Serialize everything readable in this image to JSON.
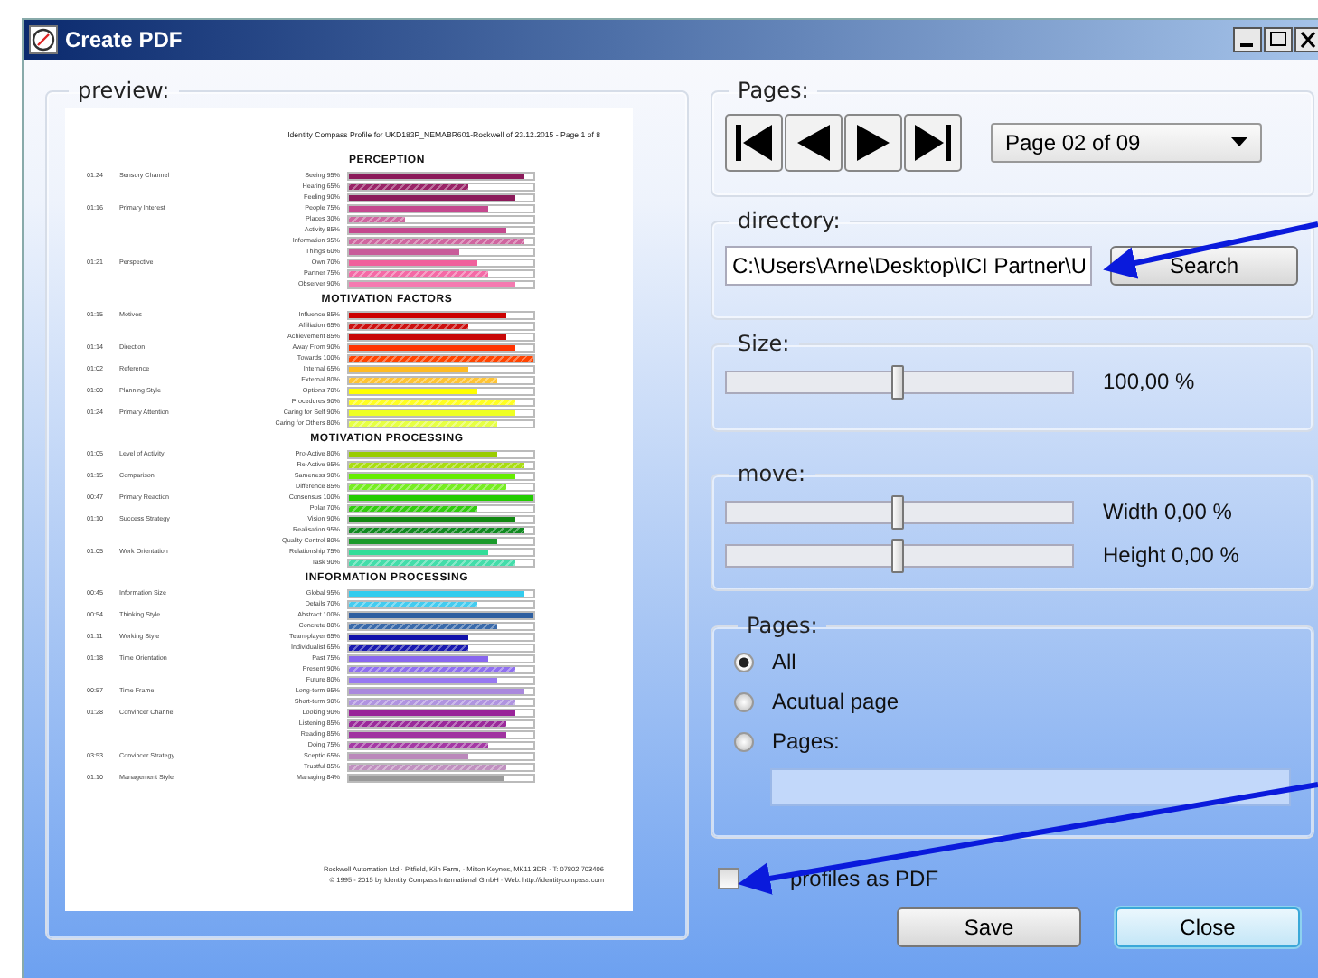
{
  "window": {
    "title": "Create PDF"
  },
  "preview": {
    "label": "preview:",
    "header": "Identity Compass Profile for UKD183P_NEMABR601-Rockwell of 23.12.2015 - Page 1 of 8",
    "sections": [
      {
        "title": "PERCEPTION",
        "groups": [
          {
            "time": "01:24",
            "name": "Sensory Channel",
            "rows": [
              {
                "label": "Seeing 95%",
                "level": 0.95,
                "color": "#8b1a5a"
              },
              {
                "label": "Hearing 65%",
                "level": 0.65,
                "color": "#9a2468"
              },
              {
                "label": "Feeling 90%",
                "level": 0.9,
                "color": "#8b1a5a"
              }
            ]
          },
          {
            "time": "01:16",
            "name": "Primary Interest",
            "rows": [
              {
                "label": "People 75%",
                "level": 0.75,
                "color": "#c4488e"
              },
              {
                "label": "Places 30%",
                "level": 0.3,
                "color": "#d066a0"
              },
              {
                "label": "Activity 85%",
                "level": 0.85,
                "color": "#c4488e"
              },
              {
                "label": "Information 95%",
                "level": 0.95,
                "color": "#d066a0"
              },
              {
                "label": "Things 60%",
                "level": 0.6,
                "color": "#c85c9a"
              }
            ]
          },
          {
            "time": "01:21",
            "name": "Perspective",
            "rows": [
              {
                "label": "Own 70%",
                "level": 0.7,
                "color": "#f0609c"
              },
              {
                "label": "Partner 75%",
                "level": 0.75,
                "color": "#f46aa6"
              },
              {
                "label": "Observer 90%",
                "level": 0.9,
                "color": "#f47ab0"
              }
            ]
          }
        ]
      },
      {
        "title": "MOTIVATION FACTORS",
        "groups": [
          {
            "time": "01:15",
            "name": "Motives",
            "rows": [
              {
                "label": "Influence 85%",
                "level": 0.85,
                "color": "#cc0000"
              },
              {
                "label": "Affiliation 65%",
                "level": 0.65,
                "color": "#cc1010"
              },
              {
                "label": "Achievement 85%",
                "level": 0.85,
                "color": "#c80808"
              }
            ]
          },
          {
            "time": "01:14",
            "name": "Direction",
            "rows": [
              {
                "label": "Away From 90%",
                "level": 0.9,
                "color": "#ff3300"
              },
              {
                "label": "Towards 100%",
                "level": 1.0,
                "color": "#ff4400"
              }
            ]
          },
          {
            "time": "01:02",
            "name": "Reference",
            "rows": [
              {
                "label": "Internal 65%",
                "level": 0.65,
                "color": "#ffbb22"
              },
              {
                "label": "External 80%",
                "level": 0.8,
                "color": "#ffc433"
              }
            ]
          },
          {
            "time": "01:00",
            "name": "Planning Style",
            "rows": [
              {
                "label": "Options 70%",
                "level": 0.7,
                "color": "#ffff00"
              },
              {
                "label": "Procedures 90%",
                "level": 0.9,
                "color": "#ffff22"
              }
            ]
          },
          {
            "time": "01:24",
            "name": "Primary Attention",
            "rows": [
              {
                "label": "Caring for Self 90%",
                "level": 0.9,
                "color": "#eeff22"
              },
              {
                "label": "Caring for Others 80%",
                "level": 0.8,
                "color": "#e6ff44"
              }
            ]
          }
        ]
      },
      {
        "title": "MOTIVATION PROCESSING",
        "groups": [
          {
            "time": "01:05",
            "name": "Level of Activity",
            "rows": [
              {
                "label": "Pro-Active 80%",
                "level": 0.8,
                "color": "#99cc00"
              },
              {
                "label": "Re-Active 95%",
                "level": 0.95,
                "color": "#aadd11"
              }
            ]
          },
          {
            "time": "01:15",
            "name": "Comparison",
            "rows": [
              {
                "label": "Sameness 90%",
                "level": 0.9,
                "color": "#66ee00"
              },
              {
                "label": "Difference 85%",
                "level": 0.85,
                "color": "#77ee22"
              }
            ]
          },
          {
            "time": "00:47",
            "name": "Primary Reaction",
            "rows": [
              {
                "label": "Consensus 100%",
                "level": 1.0,
                "color": "#22cc00"
              },
              {
                "label": "Polar 70%",
                "level": 0.7,
                "color": "#33cc11"
              }
            ]
          },
          {
            "time": "01:10",
            "name": "Success Strategy",
            "rows": [
              {
                "label": "Vision 90%",
                "level": 0.9,
                "color": "#118811"
              },
              {
                "label": "Realisation 95%",
                "level": 0.95,
                "color": "#108a20"
              },
              {
                "label": "Quality Control 80%",
                "level": 0.8,
                "color": "#1a9a2a"
              }
            ]
          },
          {
            "time": "01:05",
            "name": "Work Orientation",
            "rows": [
              {
                "label": "Relationship 75%",
                "level": 0.75,
                "color": "#33dd99"
              },
              {
                "label": "Task 90%",
                "level": 0.9,
                "color": "#44ddaa"
              }
            ]
          }
        ]
      },
      {
        "title": "INFORMATION PROCESSING",
        "groups": [
          {
            "time": "00:45",
            "name": "Information Size",
            "rows": [
              {
                "label": "Global 95%",
                "level": 0.95,
                "color": "#33ccee"
              },
              {
                "label": "Details 70%",
                "level": 0.7,
                "color": "#44ccf0"
              }
            ]
          },
          {
            "time": "00:54",
            "name": "Thinking Style",
            "rows": [
              {
                "label": "Abstract 100%",
                "level": 1.0,
                "color": "#2f5fa0"
              },
              {
                "label": "Concrete 80%",
                "level": 0.8,
                "color": "#3a6aaa"
              }
            ]
          },
          {
            "time": "01:11",
            "name": "Working Style",
            "rows": [
              {
                "label": "Team-player 65%",
                "level": 0.65,
                "color": "#1111aa"
              },
              {
                "label": "Individualist 65%",
                "level": 0.65,
                "color": "#1a1ab0"
              }
            ]
          },
          {
            "time": "01:18",
            "name": "Time Orientation",
            "rows": [
              {
                "label": "Past 75%",
                "level": 0.75,
                "color": "#8866ee"
              },
              {
                "label": "Present 90%",
                "level": 0.9,
                "color": "#9070f0"
              },
              {
                "label": "Future 80%",
                "level": 0.8,
                "color": "#9878f2"
              }
            ]
          },
          {
            "time": "00:57",
            "name": "Time Frame",
            "rows": [
              {
                "label": "Long-term 95%",
                "level": 0.95,
                "color": "#aa88dd"
              },
              {
                "label": "Short-term 90%",
                "level": 0.9,
                "color": "#b094e0"
              }
            ]
          },
          {
            "time": "01:28",
            "name": "Convincer Channel",
            "rows": [
              {
                "label": "Looking 90%",
                "level": 0.9,
                "color": "#992299"
              },
              {
                "label": "Listening 85%",
                "level": 0.85,
                "color": "#9a2a9a"
              },
              {
                "label": "Reading 85%",
                "level": 0.85,
                "color": "#a033a0"
              },
              {
                "label": "Doing 75%",
                "level": 0.75,
                "color": "#a43aa4"
              }
            ]
          },
          {
            "time": "03:53",
            "name": "Convincer Strategy",
            "rows": [
              {
                "label": "Sceptic 65%",
                "level": 0.65,
                "color": "#bb88bb"
              },
              {
                "label": "Trustful 85%",
                "level": 0.85,
                "color": "#c090c0"
              }
            ]
          },
          {
            "time": "01:10",
            "name": "Management Style",
            "rows": [
              {
                "label": "Managing 84%",
                "level": 0.84,
                "color": "#999999"
              }
            ]
          }
        ]
      }
    ],
    "footer": [
      "Rockwell Automation Ltd · Pitfield, Kiln Farm, · Milton Keynes, MK11 3DR · T: 07802 703406",
      "© 1995 - 2015 by Identity Compass International GmbH · Web: http://identitycompass.com"
    ]
  },
  "pages": {
    "label": "Pages:",
    "page_select": "Page 02 of 09"
  },
  "directory": {
    "label": "directory:",
    "value": "C:\\Users\\Arne\\Desktop\\ICI Partner\\U",
    "button": "Search"
  },
  "size": {
    "label": "Size:",
    "level": 0.49,
    "reading": "100,00 %"
  },
  "move": {
    "label": "move:",
    "sliders": [
      {
        "level": 0.49,
        "reading": "Width 0,00 %"
      },
      {
        "level": 0.49,
        "reading": "Height 0,00 %"
      }
    ]
  },
  "page_range": {
    "label": "Pages:",
    "options": [
      {
        "label": "All",
        "selected": true
      },
      {
        "label": "Acutual page",
        "selected": false
      },
      {
        "label": "Pages:",
        "selected": false
      }
    ]
  },
  "all_profiles": {
    "label": "profiles as PDF",
    "checked": false
  },
  "buttons": [
    {
      "label": "Save",
      "focused": false
    },
    {
      "label": "Close",
      "focused": true
    }
  ]
}
